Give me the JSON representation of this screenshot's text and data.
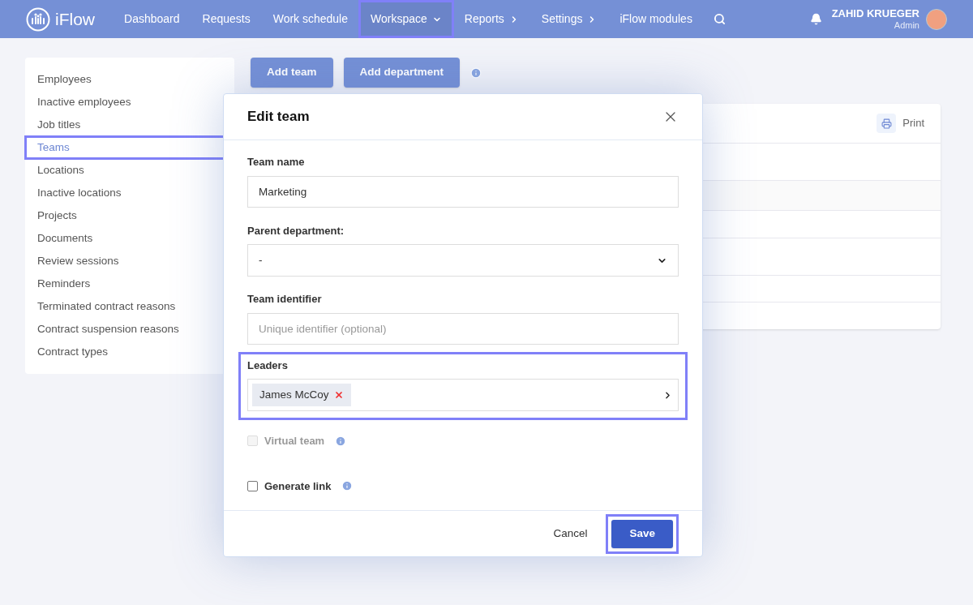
{
  "nav": {
    "logo": "iFlow",
    "items": [
      {
        "label": "Dashboard",
        "kind": "link",
        "highlighted": false
      },
      {
        "label": "Requests",
        "kind": "link",
        "highlighted": false
      },
      {
        "label": "Work schedule",
        "kind": "link",
        "highlighted": false
      },
      {
        "label": "Workspace",
        "kind": "dropdown",
        "highlighted": true
      },
      {
        "label": "Reports",
        "kind": "submenu",
        "highlighted": false
      },
      {
        "label": "Settings",
        "kind": "submenu",
        "highlighted": false
      },
      {
        "label": "iFlow modules",
        "kind": "link",
        "highlighted": false
      }
    ],
    "user": {
      "name": "ZAHID KRUEGER",
      "role": "Admin"
    }
  },
  "sidebar": {
    "items": [
      {
        "label": "Employees",
        "selected": false,
        "highlighted": false
      },
      {
        "label": "Inactive employees",
        "selected": false,
        "highlighted": false
      },
      {
        "label": "Job titles",
        "selected": false,
        "highlighted": false
      },
      {
        "label": "Teams",
        "selected": true,
        "highlighted": true
      },
      {
        "label": "Locations",
        "selected": false,
        "highlighted": false
      },
      {
        "label": "Inactive locations",
        "selected": false,
        "highlighted": false
      },
      {
        "label": "Projects",
        "selected": false,
        "highlighted": false
      },
      {
        "label": "Documents",
        "selected": false,
        "highlighted": false
      },
      {
        "label": "Review sessions",
        "selected": false,
        "highlighted": false
      },
      {
        "label": "Reminders",
        "selected": false,
        "highlighted": false
      },
      {
        "label": "Terminated contract reasons",
        "selected": false,
        "highlighted": false
      },
      {
        "label": "Contract suspension reasons",
        "selected": false,
        "highlighted": false
      },
      {
        "label": "Contract types",
        "selected": false,
        "highlighted": false
      }
    ]
  },
  "toolbar": {
    "buttons": [
      "Add team",
      "Add department"
    ]
  },
  "table": {
    "print": "Print"
  },
  "modal": {
    "title": "Edit team",
    "team_name": {
      "label": "Team name",
      "value": "Marketing"
    },
    "parent_department": {
      "label": "Parent department:",
      "value": "-"
    },
    "team_identifier": {
      "label": "Team identifier",
      "placeholder": "Unique identifier (optional)"
    },
    "leaders": {
      "label": "Leaders",
      "highlighted": true,
      "tags": [
        {
          "label": "James McCoy"
        }
      ]
    },
    "checkboxes": [
      {
        "label": "Virtual team",
        "checked": false,
        "disabled": true
      },
      {
        "label": "Generate link",
        "checked": false,
        "disabled": false
      }
    ],
    "cancel": "Cancel",
    "save": {
      "label": "Save",
      "highlighted": true
    }
  }
}
